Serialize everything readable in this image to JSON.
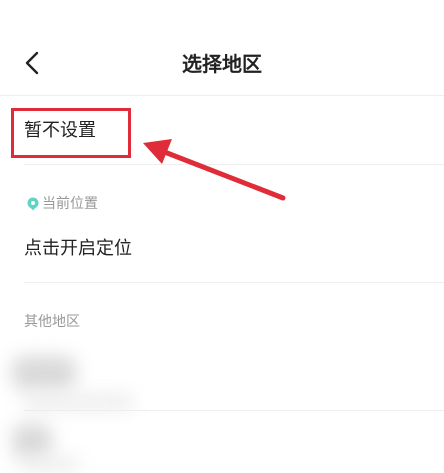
{
  "header": {
    "title": "选择地区",
    "back_icon": "chevron-left-icon"
  },
  "rows": {
    "no_setting": "暂不设置",
    "current_location_label": "当前位置",
    "current_location_icon": "location-pin-icon",
    "locate_action": "点击开启定位",
    "other_regions_label": "其他地区"
  },
  "colors": {
    "highlight": "#e02b38",
    "pin": "#5fd3c4",
    "divider": "#eeeeee",
    "muted_text": "#999999"
  },
  "annotation": {
    "type": "red-arrow-with-box",
    "target": "no_setting"
  }
}
